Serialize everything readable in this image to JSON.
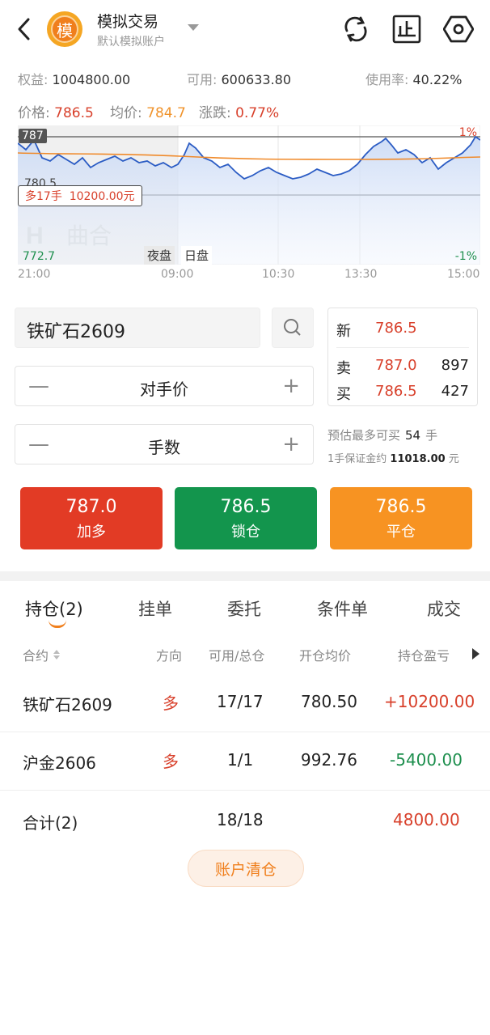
{
  "header": {
    "logo_char": "模",
    "title": "模拟交易",
    "subtitle": "默认模拟账户",
    "icons": [
      "back-arrow-icon",
      "refresh-icon",
      "stop-icon",
      "settings-hex-icon"
    ]
  },
  "stats": {
    "equity_label": "权益:",
    "equity_value": "1004800.00",
    "available_label": "可用:",
    "available_value": "600633.80",
    "usage_label": "使用率:",
    "usage_value": "40.22%"
  },
  "price_summary": {
    "price_label": "价格:",
    "price_value": "786.5",
    "avg_label": "均价:",
    "avg_value": "784.7",
    "change_label": "涨跌:",
    "change_value": "0.77%"
  },
  "chart": {
    "current_tag": "787",
    "top_right": "1%",
    "bottom_right": "-1%",
    "partial_left_label": "780.5",
    "bottom_left": "772.7",
    "position_tag": "多17手  10200.00元",
    "watermark": "曲合",
    "session_night": "夜盘",
    "session_day": "日盘",
    "x_ticks": [
      "21:00",
      "09:00",
      "10:30",
      "13:30",
      "15:00"
    ],
    "colors": {
      "price": "#2b5cc4",
      "avg": "#f0932b",
      "fill": "#e6eefb",
      "night_shade": "#eeeeee"
    }
  },
  "order": {
    "symbol": "铁矿石2609",
    "price_type": "对手价",
    "quantity_placeholder": "手数",
    "minus": "—",
    "plus": "+"
  },
  "quote": {
    "new_label": "新",
    "new_price": "786.5",
    "sell_label": "卖",
    "sell_price": "787.0",
    "sell_vol": "897",
    "buy_label": "买",
    "buy_price": "786.5",
    "buy_vol": "427"
  },
  "estimate": {
    "prefix": "预估最多可买",
    "value": "54",
    "unit": "手",
    "margin_prefix": "1手保证金约",
    "margin_value": "11018.00",
    "margin_unit": "元"
  },
  "actions": [
    {
      "price": "787.0",
      "label": "加多",
      "color": "#e23b25"
    },
    {
      "price": "786.5",
      "label": "锁仓",
      "color": "#13954d"
    },
    {
      "price": "786.5",
      "label": "平仓",
      "color": "#f79322"
    }
  ],
  "tabs": [
    "持仓(2)",
    "挂单",
    "委托",
    "条件单",
    "成交"
  ],
  "columns": [
    "合约",
    "方向",
    "可用/总仓",
    "开仓均价",
    "持仓盈亏"
  ],
  "positions": [
    {
      "contract": "铁矿石2609",
      "dir": "多",
      "qty": "17/17",
      "avg": "780.50",
      "pnl": "+10200.00"
    },
    {
      "contract": "沪金2606",
      "dir": "多",
      "qty": "1/1",
      "avg": "992.76",
      "pnl": "-5400.00"
    }
  ],
  "total": {
    "label": "合计(2)",
    "qty": "18/18",
    "pnl": "4800.00"
  },
  "close_all": "账户清仓"
}
